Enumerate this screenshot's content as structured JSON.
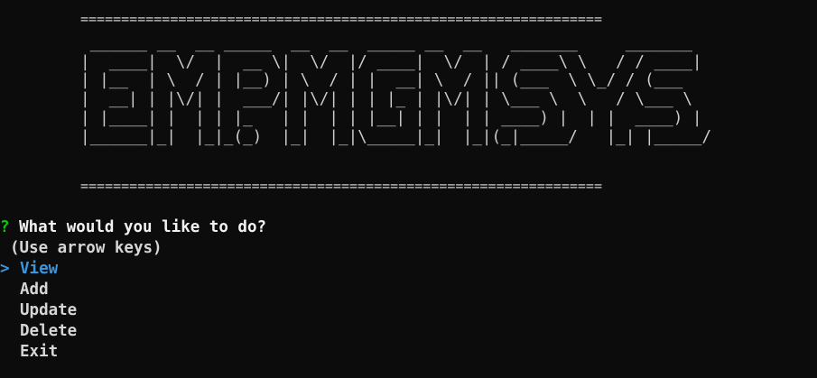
{
  "banner": {
    "rule": "================================================================",
    "art": " ______ __  __ _____  __  __  _____ __  __   _______     _______\n|  ____|  \\/  |  __ \\|  \\/  |/ ____|  \\/  | / ____\\ \\   / / ____|\n| |__  | \\  / | |__) | \\  / | |  __| \\  / || (___  \\ \\_/ / (___\n|  __| | |\\/| |  ___/| |\\/| | | |_ | |\\/| | \\___ \\  \\   / \\___ \\\n| |____| |  | | |_   | |  | | |__| | |  | | ____) |  | |  ____) |\n|______|_|  |_|_(_)  |_|  |_|\\_____|_|  |_|(_|_____/   |_| |_____/"
  },
  "prompt": {
    "marker": "?",
    "question": "What would you like to do?",
    "hint": "(Use arrow keys)"
  },
  "menu": {
    "pointer": ">",
    "selected_index": 0,
    "items": [
      "View",
      "Add",
      "Update",
      "Delete",
      "Exit"
    ]
  },
  "colors": {
    "background": "#0c0c0c",
    "foreground": "#d6d6d6",
    "marker": "#16c60c",
    "selected": "#3a96dd"
  }
}
